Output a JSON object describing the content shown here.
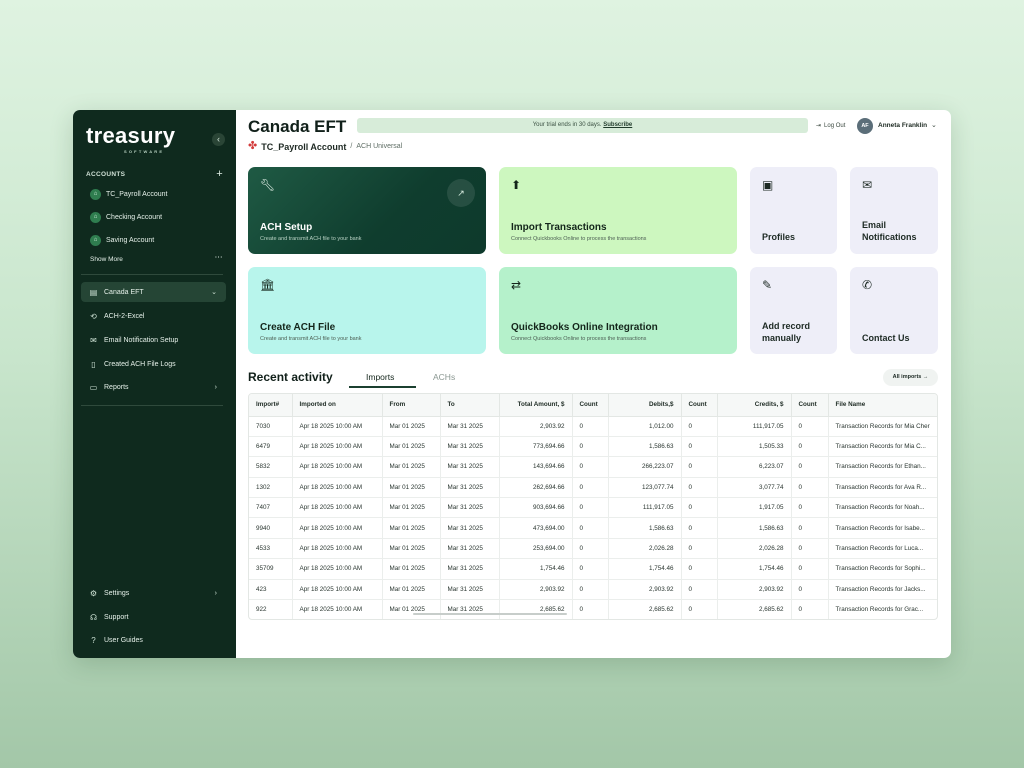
{
  "sidebar": {
    "logo": "treasury",
    "logo_sub": "SOFTWARE",
    "collapse_icon": "chevron-left-icon",
    "accounts_heading": "ACCOUNTS",
    "accounts": [
      {
        "label": "TC_Payroll Account"
      },
      {
        "label": "Checking Account"
      },
      {
        "label": "Saving Account"
      }
    ],
    "show_more": "Show More",
    "nav": [
      {
        "label": "Canada EFT",
        "icon": "table-icon",
        "active": true
      },
      {
        "label": "ACH-2-Excel",
        "icon": "sync-icon"
      },
      {
        "label": "Email Notification Setup",
        "icon": "mail-icon"
      },
      {
        "label": "Created ACH File Logs",
        "icon": "file-icon"
      },
      {
        "label": "Reports",
        "icon": "folder-icon"
      }
    ],
    "footer": [
      {
        "label": "Settings",
        "icon": "gear-icon"
      },
      {
        "label": "Support",
        "icon": "headset-icon"
      },
      {
        "label": "User Guides",
        "icon": "help-icon"
      }
    ]
  },
  "header": {
    "title": "Canada EFT",
    "trial_text": "Your trial ends in 30 days.",
    "trial_link": "Subscribe",
    "logout": "Log Out",
    "user_initials": "AF",
    "user_name": "Anneta Franklin"
  },
  "breadcrumb": {
    "account": "TC_Payroll Account",
    "separator": "/",
    "section": "ACH Universal"
  },
  "cards": {
    "ach_setup": {
      "title": "ACH Setup",
      "desc": "Create and transmit ACH file to your bank"
    },
    "import_transactions": {
      "title": "Import Transactions",
      "desc": "Connect Quickbooks Online to process the transactions"
    },
    "profiles": {
      "title": "Profiles"
    },
    "email_notifications": {
      "title": "Email Notifications"
    },
    "create_ach_file": {
      "title": "Create ACH File",
      "desc": "Create and transmit ACH file to your bank"
    },
    "qbo_integration": {
      "title": "QuickBooks Online Integration",
      "desc": "Connect Quickbooks Online to process the transactions"
    },
    "add_record": {
      "title": "Add record manually"
    },
    "contact_us": {
      "title": "Contact Us"
    }
  },
  "recent": {
    "title": "Recent activity",
    "tabs": [
      "Imports",
      "ACHs"
    ],
    "all_imports": "All imports →",
    "columns": [
      "Import#",
      "Imported on",
      "From",
      "To",
      "Total Amount, $",
      "Count",
      "Debits,$",
      "Count",
      "Credits, $",
      "Count",
      "File Name"
    ],
    "rows": [
      [
        "7030",
        "Apr 18 2025 10:00 AM",
        "Mar 01 2025",
        "Mar 31 2025",
        "2,903.92",
        "0",
        "1,012.00",
        "0",
        "111,917.05",
        "0",
        "Transaction Records for Mia Cher"
      ],
      [
        "6479",
        "Apr 18 2025 10:00 AM",
        "Mar 01 2025",
        "Mar 31 2025",
        "773,694.66",
        "0",
        "1,586.63",
        "0",
        "1,505.33",
        "0",
        "Transaction Records for Mia C..."
      ],
      [
        "5832",
        "Apr 18 2025 10:00 AM",
        "Mar 01 2025",
        "Mar 31 2025",
        "143,694.66",
        "0",
        "266,223.07",
        "0",
        "6,223.07",
        "0",
        "Transaction Records for Ethan..."
      ],
      [
        "1302",
        "Apr 18 2025 10:00 AM",
        "Mar 01 2025",
        "Mar 31 2025",
        "262,694.66",
        "0",
        "123,077.74",
        "0",
        "3,077.74",
        "0",
        "Transaction Records for Ava R..."
      ],
      [
        "7407",
        "Apr 18 2025 10:00 AM",
        "Mar 01 2025",
        "Mar 31 2025",
        "903,694.66",
        "0",
        "111,917.05",
        "0",
        "1,917.05",
        "0",
        "Transaction Records for Noah..."
      ],
      [
        "9940",
        "Apr 18 2025 10:00 AM",
        "Mar 01 2025",
        "Mar 31 2025",
        "473,694.00",
        "0",
        "1,586.63",
        "0",
        "1,586.63",
        "0",
        "Transaction Records for Isabe..."
      ],
      [
        "4533",
        "Apr 18 2025 10:00 AM",
        "Mar 01 2025",
        "Mar 31 2025",
        "253,694.00",
        "0",
        "2,026.28",
        "0",
        "2,026.28",
        "0",
        "Transaction Records for Luca..."
      ],
      [
        "35709",
        "Apr 18 2025 10:00 AM",
        "Mar 01 2025",
        "Mar 31 2025",
        "1,754.46",
        "0",
        "1,754.46",
        "0",
        "1,754.46",
        "0",
        "Transaction Records for Sophi..."
      ],
      [
        "423",
        "Apr 18 2025 10:00 AM",
        "Mar 01 2025",
        "Mar 31 2025",
        "2,903.92",
        "0",
        "2,903.92",
        "0",
        "2,903.92",
        "0",
        "Transaction Records for Jacks..."
      ],
      [
        "922",
        "Apr 18 2025 10:00 AM",
        "Mar 01 2025",
        "Mar 31 2025",
        "2,685.62",
        "0",
        "2,685.62",
        "0",
        "2,685.62",
        "0",
        "Transaction Records for Grac..."
      ]
    ]
  },
  "colors": {
    "sidebar_bg": "#0f2a1e",
    "accent_dark": "#1b4030",
    "card_lime": "#cdf7bf",
    "card_cyan": "#b8f5ec",
    "card_mint": "#b5f1cb",
    "card_grey": "#eeeef8"
  }
}
